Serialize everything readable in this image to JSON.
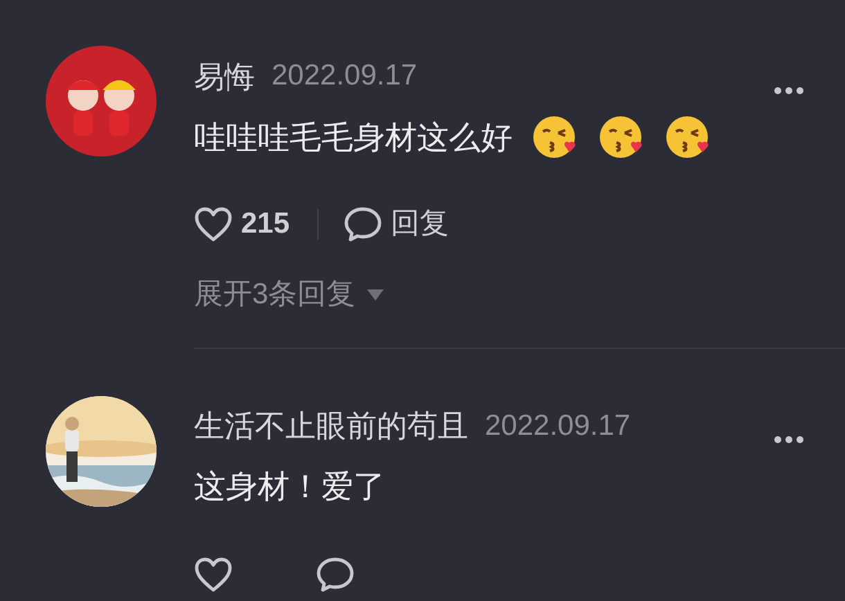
{
  "comments": [
    {
      "avatar": {
        "kind": "cartoon"
      },
      "author": "易悔",
      "date": "2022.09.17",
      "text": "哇哇哇毛毛身材这么好",
      "emojis": [
        {
          "kind": "kiss"
        },
        {
          "kind": "kiss"
        },
        {
          "kind": "kiss"
        }
      ],
      "likes": "215",
      "reply_label": "回复",
      "expand_label": "展开3条回复"
    },
    {
      "author": "生活不止眼前的苟且",
      "date": "2022.09.17",
      "text": "这身材！爱了"
    }
  ]
}
